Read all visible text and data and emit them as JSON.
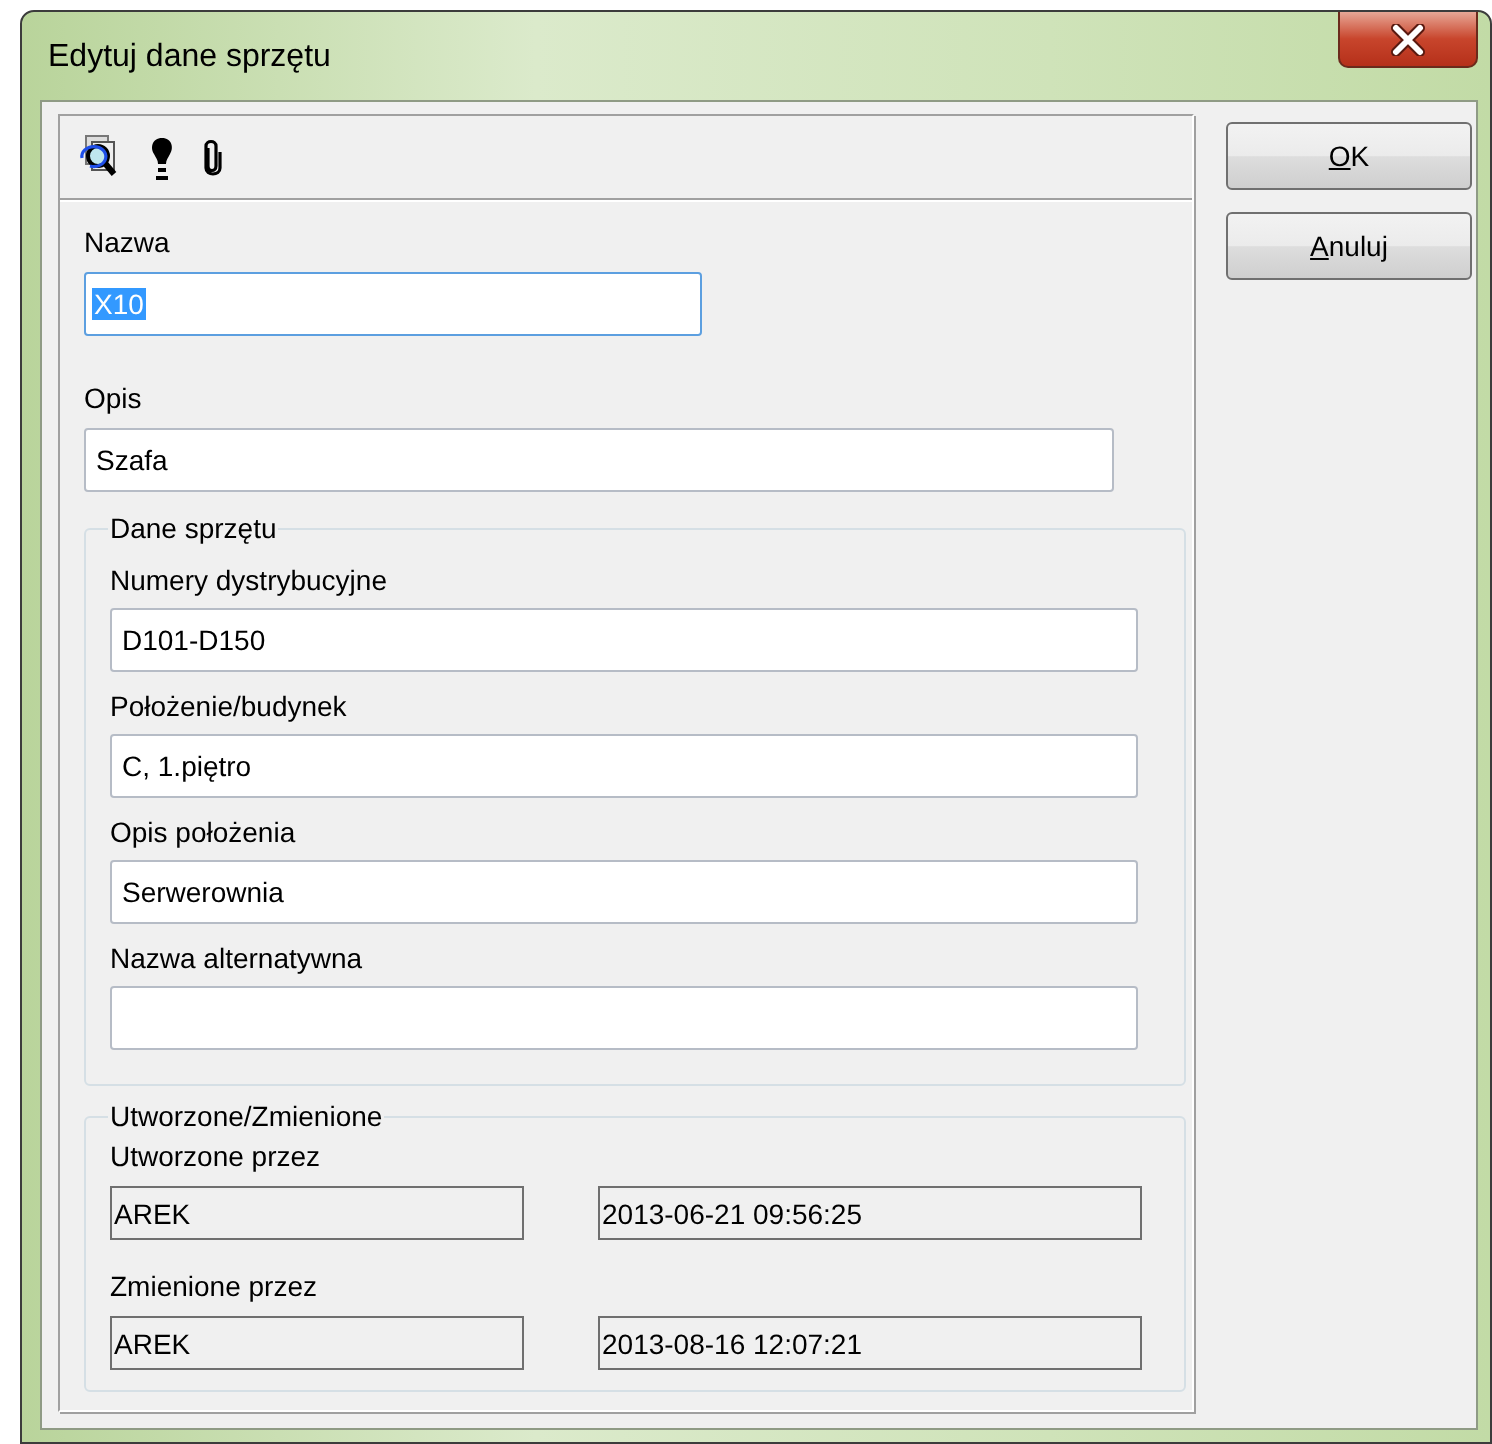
{
  "window": {
    "title": "Edytuj dane sprzętu"
  },
  "fields": [
    {
      "label": "Nazwa",
      "value": "X10",
      "text_selected": true
    },
    {
      "label": "Opis",
      "value": "Szafa",
      "text_selected": false
    }
  ],
  "equipment_group": {
    "title": "Dane sprzętu",
    "fields": [
      {
        "label": "Numery dystrybucyjne",
        "value": "D101-D150"
      },
      {
        "label": "Położenie/budynek",
        "value": "C, 1.piętro"
      },
      {
        "label": "Opis położenia",
        "value": "Serwerownia"
      },
      {
        "label": "Nazwa alternatywna"
      }
    ]
  },
  "audit_group": {
    "title": "Utworzone/Zmienione",
    "rows": [
      {
        "label": "Utworzone przez",
        "user": "AREK",
        "date": "2013-06-21 09:56:25"
      },
      {
        "label": "Zmienione przez",
        "user": "AREK",
        "date": "2013-08-16 12:07:21"
      }
    ]
  },
  "buttons": [
    {
      "label": "OK",
      "accel_underlined": true
    },
    {
      "label": "Anuluj",
      "accel_underlined": true
    }
  ]
}
